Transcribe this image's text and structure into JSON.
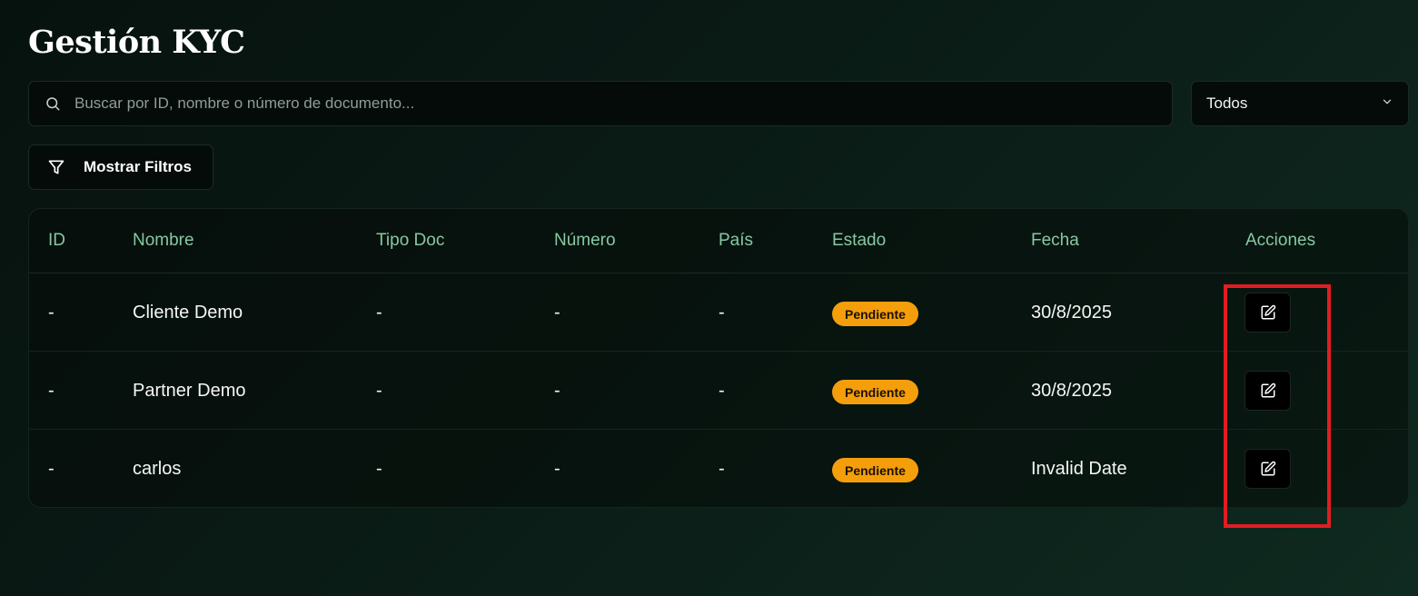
{
  "page": {
    "title": "Gestión KYC"
  },
  "search": {
    "placeholder": "Buscar por ID, nombre o número de documento...",
    "value": ""
  },
  "status_filter": {
    "selected": "Todos"
  },
  "filters_button": {
    "label": "Mostrar Filtros"
  },
  "table": {
    "columns": [
      "ID",
      "Nombre",
      "Tipo Doc",
      "Número",
      "País",
      "Estado",
      "Fecha",
      "Acciones"
    ],
    "rows": [
      {
        "id": "-",
        "nombre": "Cliente Demo",
        "tipo_doc": "-",
        "numero": "-",
        "pais": "-",
        "estado": "Pendiente",
        "fecha": "30/8/2025"
      },
      {
        "id": "-",
        "nombre": "Partner Demo",
        "tipo_doc": "-",
        "numero": "-",
        "pais": "-",
        "estado": "Pendiente",
        "fecha": "30/8/2025"
      },
      {
        "id": "-",
        "nombre": "carlos",
        "tipo_doc": "-",
        "numero": "-",
        "pais": "-",
        "estado": "Pendiente",
        "fecha": "Invalid Date"
      }
    ]
  },
  "icons": {
    "search": "search-icon",
    "dropdown": "chevron-down-icon",
    "filter": "filter-icon",
    "edit": "edit-icon"
  },
  "colors": {
    "header_text": "#86c9a2",
    "badge_pending": "#f59e0b",
    "highlight": "#e11d23"
  }
}
